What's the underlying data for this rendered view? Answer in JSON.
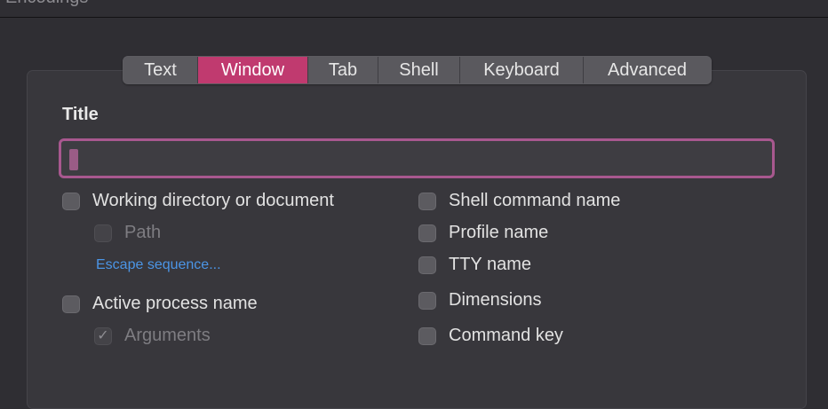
{
  "header": {
    "section_label": "Encodings"
  },
  "tabs": [
    {
      "label": "Text",
      "active": false
    },
    {
      "label": "Window",
      "active": true
    },
    {
      "label": "Tab",
      "active": false
    },
    {
      "label": "Shell",
      "active": false
    },
    {
      "label": "Keyboard",
      "active": false
    },
    {
      "label": "Advanced",
      "active": false
    }
  ],
  "title_section": {
    "heading": "Title",
    "field_value": ""
  },
  "left_options": {
    "working_directory": {
      "label": "Working directory or document",
      "checked": false
    },
    "path": {
      "label": "Path",
      "checked": false,
      "enabled": false
    },
    "escape_link": "Escape sequence...",
    "active_process": {
      "label": "Active process name",
      "checked": false
    },
    "arguments": {
      "label": "Arguments",
      "checked": true,
      "enabled": false
    }
  },
  "right_options": {
    "shell_command": {
      "label": "Shell command name",
      "checked": false
    },
    "profile_name": {
      "label": "Profile name",
      "checked": false
    },
    "tty_name": {
      "label": "TTY name",
      "checked": false
    },
    "dimensions": {
      "label": "Dimensions",
      "checked": false
    },
    "command_key": {
      "label": "Command key",
      "checked": false
    }
  },
  "colors": {
    "accent": "#c03a6f",
    "focus_ring": "#a8588f",
    "link": "#4b95e6",
    "background": "#2f2e33"
  },
  "icons": {
    "checkmark": "checkmark-icon"
  }
}
